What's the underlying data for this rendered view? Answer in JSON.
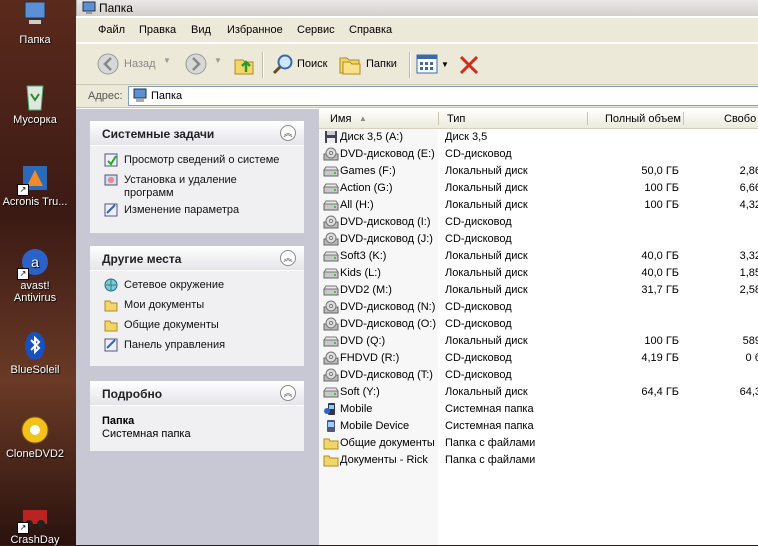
{
  "desktop": {
    "icons": [
      {
        "label": "Папка",
        "icon": "folder-computer-icon"
      },
      {
        "label": "Мусорка",
        "icon": "recycle-bin-icon"
      },
      {
        "label": "Acronis Tru...",
        "icon": "acronis-icon"
      },
      {
        "label": "avast! Antivirus",
        "icon": "avast-icon"
      },
      {
        "label": "BlueSoleil",
        "icon": "bluetooth-icon"
      },
      {
        "label": "CloneDVD2",
        "icon": "clonedvd-icon"
      },
      {
        "label": "CrashDay",
        "icon": "crashday-icon"
      }
    ]
  },
  "window": {
    "title": "Папка",
    "menu": [
      "Файл",
      "Правка",
      "Вид",
      "Избранное",
      "Сервис",
      "Справка"
    ],
    "toolbar": {
      "back": "Назад",
      "search": "Поиск",
      "folders": "Папки"
    },
    "address": {
      "label": "Адрес:",
      "value": "Папка"
    }
  },
  "tasks": {
    "system": {
      "title": "Системные задачи",
      "items": [
        "Просмотр сведений о системе",
        "Установка и удаление программ",
        "Изменение параметра"
      ]
    },
    "places": {
      "title": "Другие места",
      "items": [
        "Сетевое окружение",
        "Мои документы",
        "Общие документы",
        "Панель управления"
      ]
    },
    "details": {
      "title": "Подробно",
      "name": "Папка",
      "desc": "Системная папка"
    }
  },
  "columns": {
    "name": "Имя",
    "type": "Тип",
    "total": "Полный объем",
    "free": "Свобо"
  },
  "rows": [
    {
      "name": "Диск 3,5 (A:)",
      "type": "Диск 3,5",
      "total": "",
      "free": "",
      "icon": "floppy-icon"
    },
    {
      "name": "DVD-дисковод (E:)",
      "type": "CD-дисковод",
      "total": "",
      "free": "",
      "icon": "cd-drive-icon"
    },
    {
      "name": "Games (F:)",
      "type": "Локальный диск",
      "total": "50,0 ГБ",
      "free": "2,86",
      "icon": "hard-drive-icon"
    },
    {
      "name": "Action (G:)",
      "type": "Локальный диск",
      "total": "100 ГБ",
      "free": "6,66",
      "icon": "hard-drive-icon"
    },
    {
      "name": "All (H:)",
      "type": "Локальный диск",
      "total": "100 ГБ",
      "free": "4,32",
      "icon": "hard-drive-icon"
    },
    {
      "name": "DVD-дисковод (I:)",
      "type": "CD-дисковод",
      "total": "",
      "free": "",
      "icon": "cd-drive-icon"
    },
    {
      "name": "DVD-дисковод (J:)",
      "type": "CD-дисковод",
      "total": "",
      "free": "",
      "icon": "cd-drive-icon"
    },
    {
      "name": "Soft3 (K:)",
      "type": "Локальный диск",
      "total": "40,0 ГБ",
      "free": "3,32",
      "icon": "hard-drive-icon"
    },
    {
      "name": "Kids (L:)",
      "type": "Локальный диск",
      "total": "40,0 ГБ",
      "free": "1,85",
      "icon": "hard-drive-icon"
    },
    {
      "name": "DVD2 (M:)",
      "type": "Локальный диск",
      "total": "31,7 ГБ",
      "free": "2,58",
      "icon": "hard-drive-icon"
    },
    {
      "name": "DVD-дисковод (N:)",
      "type": "CD-дисковод",
      "total": "",
      "free": "",
      "icon": "cd-drive-icon"
    },
    {
      "name": "DVD-дисковод (O:)",
      "type": "CD-дисковод",
      "total": "",
      "free": "",
      "icon": "cd-drive-icon"
    },
    {
      "name": "DVD (Q:)",
      "type": "Локальный диск",
      "total": "100 ГБ",
      "free": "589",
      "icon": "hard-drive-icon"
    },
    {
      "name": "FHDVD (R:)",
      "type": "CD-дисковод",
      "total": "4,19 ГБ",
      "free": "0 б",
      "icon": "cd-drive-icon"
    },
    {
      "name": "DVD-дисковод (T:)",
      "type": "CD-дисковод",
      "total": "",
      "free": "",
      "icon": "cd-drive-icon"
    },
    {
      "name": "Soft (Y:)",
      "type": "Локальный диск",
      "total": "64,4 ГБ",
      "free": "64,3",
      "icon": "hard-drive-icon"
    },
    {
      "name": "Mobile",
      "type": "Системная папка",
      "total": "",
      "free": "",
      "icon": "mobile-icon"
    },
    {
      "name": "Mobile Device",
      "type": "Системная папка",
      "total": "",
      "free": "",
      "icon": "mobile-device-icon"
    },
    {
      "name": "Общие документы",
      "type": "Папка с файлами",
      "total": "",
      "free": "",
      "icon": "folder-icon"
    },
    {
      "name": "Документы - Rick",
      "type": "Папка с файлами",
      "total": "",
      "free": "",
      "icon": "folder-icon"
    }
  ]
}
